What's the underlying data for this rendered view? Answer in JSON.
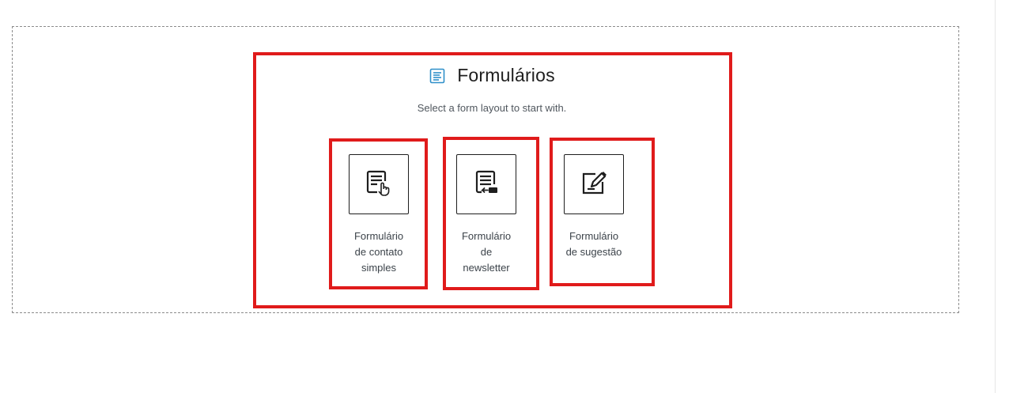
{
  "block": {
    "title": "Formulários",
    "subtitle": "Select a form layout to start with.",
    "title_icon": "form-list-icon",
    "accent_color": "#2e8fc9"
  },
  "templates": [
    {
      "label": "Formulário de contato simples",
      "lines": [
        "Formulário",
        "de contato",
        "simples"
      ],
      "icon": "form-click-icon"
    },
    {
      "label": "Formulário de newsletter",
      "lines": [
        "Formulário",
        "de",
        "newsletter"
      ],
      "icon": "form-newsletter-icon"
    },
    {
      "label": "Formulário de sugestão",
      "lines": [
        "Formulário",
        "de sugestão"
      ],
      "icon": "form-edit-icon"
    }
  ],
  "annotation_color": "#e01b1b"
}
